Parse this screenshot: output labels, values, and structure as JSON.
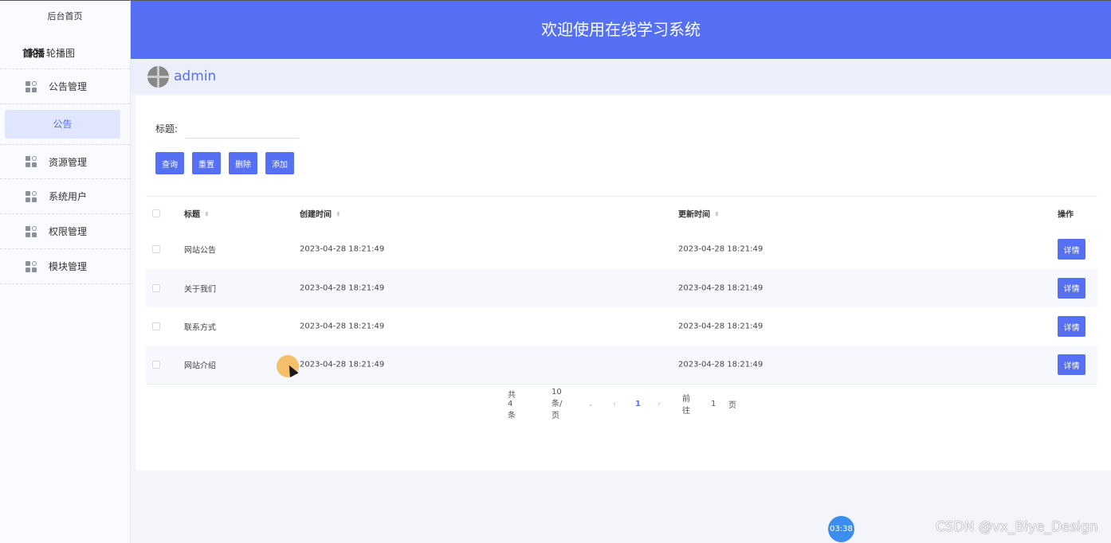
{
  "sidebar": {
    "home": "后台首页",
    "carousel_overlap": "首轮播",
    "carousel": "轮播图",
    "menus": [
      {
        "label": "公告管理",
        "icon": "grid-icon"
      },
      {
        "label": "资源管理",
        "icon": "grid-icon"
      },
      {
        "label": "系统用户",
        "icon": "grid-icon"
      },
      {
        "label": "权限管理",
        "icon": "grid-icon"
      },
      {
        "label": "模块管理",
        "icon": "grid-icon"
      }
    ],
    "active_sub": "公告"
  },
  "header": {
    "title": "欢迎使用在线学习系统",
    "username": "admin"
  },
  "search": {
    "label": "标题:",
    "value": ""
  },
  "toolbar": {
    "query": "查询",
    "reset": "重置",
    "delete": "删除",
    "add": "添加"
  },
  "table": {
    "columns": [
      "标题",
      "创建时间",
      "更新时间",
      "操作"
    ],
    "rows": [
      {
        "title": "网站公告",
        "created": "2023-04-28 18:21:49",
        "updated": "2023-04-28 18:21:49",
        "action": "详情"
      },
      {
        "title": "关于我们",
        "created": "2023-04-28 18:21:49",
        "updated": "2023-04-28 18:21:49",
        "action": "详情"
      },
      {
        "title": "联系方式",
        "created": "2023-04-28 18:21:49",
        "updated": "2023-04-28 18:21:49",
        "action": "详情"
      },
      {
        "title": "网站介绍",
        "created": "2023-04-28 18:21:49",
        "updated": "2023-04-28 18:21:49",
        "action": "详情"
      }
    ]
  },
  "pagination": {
    "total": "共 4 条",
    "page_size": "10条/页",
    "current": "1",
    "goto_label": "前往",
    "goto_value": "1",
    "unit": "页"
  },
  "overlay": {
    "timer": "03:38",
    "watermark": "CSDN @vx_Biye_Design"
  },
  "colors": {
    "primary": "#5670f5",
    "active_bg": "#dfe6fd"
  }
}
